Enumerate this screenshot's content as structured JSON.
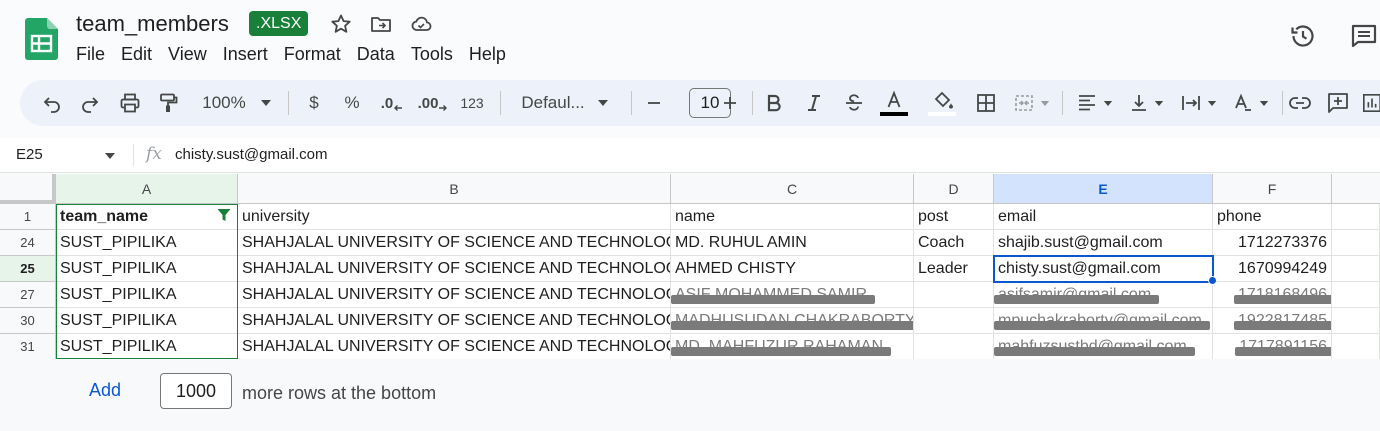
{
  "app": {
    "doc_title": "team_members",
    "file_badge": ".XLSX",
    "menus": [
      "File",
      "Edit",
      "View",
      "Insert",
      "Format",
      "Data",
      "Tools",
      "Help"
    ]
  },
  "toolbar": {
    "zoom": "100%",
    "currency": "$",
    "percent": "%",
    "decrease_decimal": ".0",
    "increase_decimal": ".00",
    "number_format": "123",
    "font_family": "Defaul...",
    "font_size": "10"
  },
  "formula_bar": {
    "name_box": "E25",
    "fx": "fx",
    "value": "chisty.sust@gmail.com"
  },
  "grid": {
    "columns": [
      "A",
      "B",
      "C",
      "D",
      "E",
      "F"
    ],
    "rows": [
      {
        "num": "1",
        "cells": [
          "team_name",
          "university",
          "name",
          "post",
          "email",
          "phone"
        ]
      },
      {
        "num": "24",
        "cells": [
          "SUST_PIPILIKA",
          "SHAHJALAL UNIVERSITY OF SCIENCE AND TECHNOLOGY",
          "MD. RUHUL AMIN",
          "Coach",
          "shajib.sust@gmail.com",
          "1712273376"
        ]
      },
      {
        "num": "25",
        "cells": [
          "SUST_PIPILIKA",
          "SHAHJALAL UNIVERSITY OF SCIENCE AND TECHNOLOGY",
          "AHMED CHISTY",
          "Leader",
          "chisty.sust@gmail.com",
          "1670994249"
        ]
      },
      {
        "num": "27",
        "cells": [
          "SUST_PIPILIKA",
          "SHAHJALAL UNIVERSITY OF SCIENCE AND TECHNOLOGY",
          "ASIF MOHAMMED SAMIR",
          "",
          "asifsamir@gmail.com",
          "1718168496"
        ]
      },
      {
        "num": "30",
        "cells": [
          "SUST_PIPILIKA",
          "SHAHJALAL UNIVERSITY OF SCIENCE AND TECHNOLOGY",
          "MADHUSUDAN CHAKRABORTY",
          "",
          "mpuchakraborty@gmail.com",
          "1922817485"
        ]
      },
      {
        "num": "31",
        "cells": [
          "SUST_PIPILIKA",
          "SHAHJALAL UNIVERSITY OF SCIENCE AND TECHNOLOGY",
          "MD. MAHFUZUR RAHAMAN",
          "",
          "mahfuzsustbd@gmail.com",
          "1717891156"
        ]
      }
    ]
  },
  "footer": {
    "add_label": "Add",
    "rows_count": "1000",
    "rows_text": "more rows at the bottom"
  },
  "colors": {
    "brand_green": "#188038",
    "selection_blue": "#0b57d0"
  }
}
